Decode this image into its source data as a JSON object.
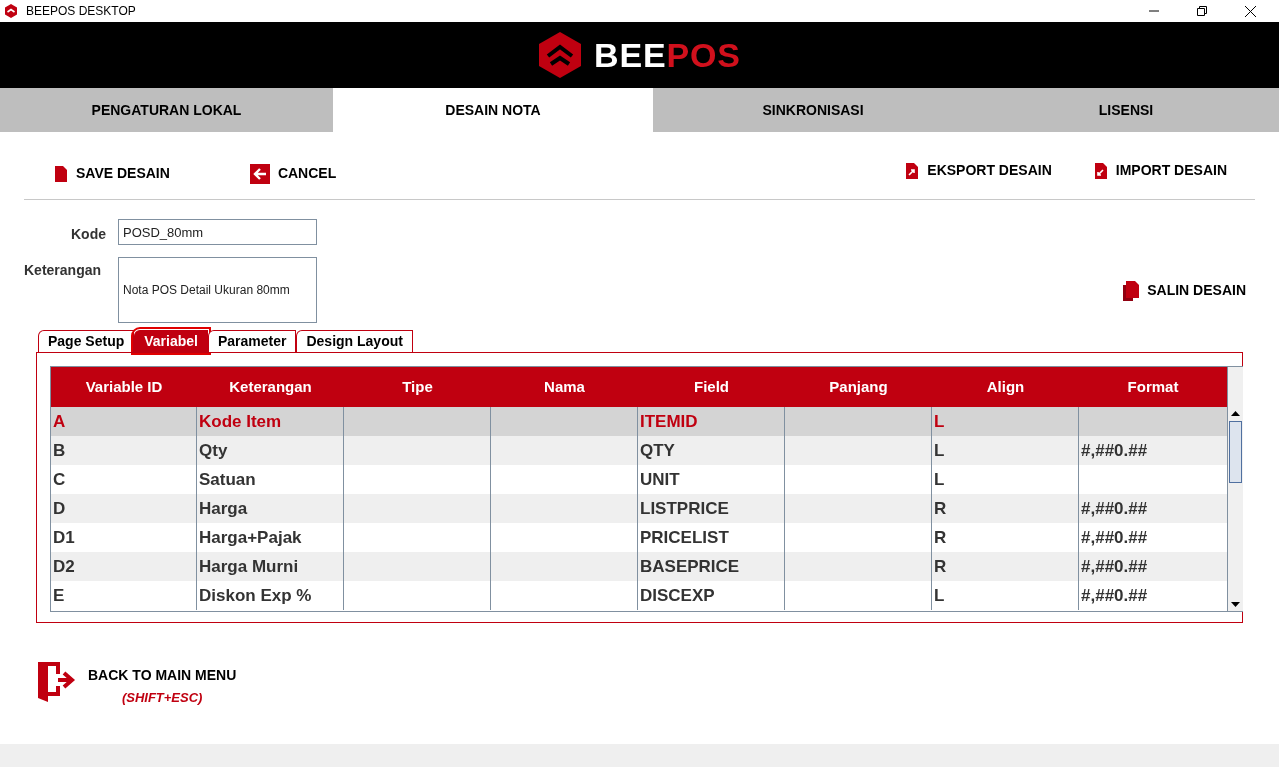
{
  "window": {
    "title": "BEEPOS DESKTOP"
  },
  "logo": {
    "primary": "BEE",
    "accent": "POS"
  },
  "main_tabs": [
    {
      "label": "PENGATURAN LOKAL",
      "selected": false
    },
    {
      "label": "DESAIN NOTA",
      "selected": true
    },
    {
      "label": "SINKRONISASI",
      "selected": false
    },
    {
      "label": "LISENSI",
      "selected": false
    }
  ],
  "toolbar": {
    "left": [
      {
        "kind": "save",
        "label": "SAVE DESAIN"
      },
      {
        "kind": "cancel",
        "label": "CANCEL"
      }
    ],
    "right": [
      {
        "kind": "export",
        "label": "EKSPORT DESAIN"
      },
      {
        "kind": "import",
        "label": "IMPORT DESAIN"
      }
    ]
  },
  "form": {
    "kode_label": "Kode",
    "kode_value": "POSD_80mm",
    "keterangan_label": "Keterangan",
    "keterangan_value": "Nota POS Detail Ukuran 80mm",
    "copy_button": "SALIN DESAIN"
  },
  "sub_tabs": [
    {
      "label": "Page Setup",
      "selected": false
    },
    {
      "label": "Variabel",
      "selected": true
    },
    {
      "label": "Parameter",
      "selected": false
    },
    {
      "label": "Design Layout",
      "selected": false
    }
  ],
  "table": {
    "columns": [
      "Variable ID",
      "Keterangan",
      "Tipe",
      "Nama",
      "Field",
      "Panjang",
      "Align",
      "Format"
    ],
    "rows": [
      {
        "cells": [
          "A",
          "Kode Item",
          "",
          "",
          "ITEMID",
          "",
          "L",
          ""
        ],
        "selected": true
      },
      {
        "cells": [
          "B",
          "Qty",
          "",
          "",
          "QTY",
          "",
          "L",
          "#,##0.##"
        ],
        "selected": false
      },
      {
        "cells": [
          "C",
          "Satuan",
          "",
          "",
          "UNIT",
          "",
          "L",
          ""
        ],
        "selected": false
      },
      {
        "cells": [
          "D",
          "Harga",
          "",
          "",
          "LISTPRICE",
          "",
          "R",
          "#,##0.##"
        ],
        "selected": false
      },
      {
        "cells": [
          "D1",
          "Harga+Pajak",
          "",
          "",
          "PRICELIST",
          "",
          "R",
          "#,##0.##"
        ],
        "selected": false
      },
      {
        "cells": [
          "D2",
          "Harga Murni",
          "",
          "",
          "BASEPRICE",
          "",
          "R",
          "#,##0.##"
        ],
        "selected": false
      },
      {
        "cells": [
          "E",
          "Diskon Exp %",
          "",
          "",
          "DISCEXP",
          "",
          "L",
          "#,##0.##"
        ],
        "selected": false
      }
    ]
  },
  "back": {
    "label": "BACK TO MAIN MENU",
    "shortcut": "(SHIFT+ESC)"
  }
}
